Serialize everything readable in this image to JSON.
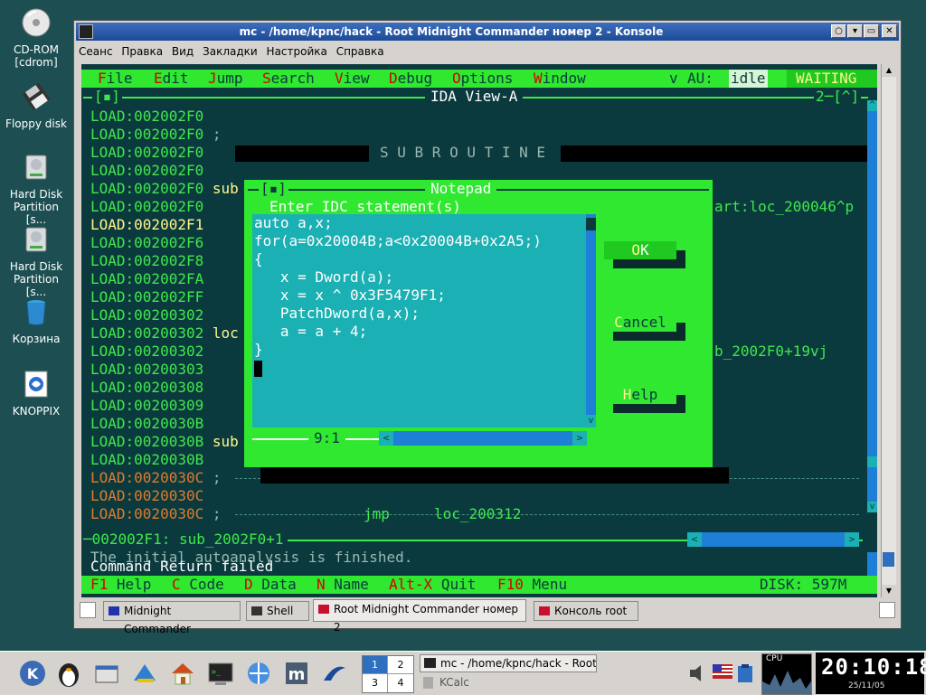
{
  "desktop": {
    "icons": [
      {
        "label": "CD-ROM\n[cdrom]",
        "icon": "cdrom-icon"
      },
      {
        "label": "Floppy disk",
        "icon": "floppy-icon"
      },
      {
        "label": "Hard Disk\nPartition [s...",
        "icon": "harddisk-icon"
      },
      {
        "label": "Hard Disk\nPartition [s...",
        "icon": "harddisk-icon"
      },
      {
        "label": "Корзина",
        "icon": "trash-icon"
      },
      {
        "label": "KNOPPIX",
        "icon": "knoppix-icon"
      }
    ]
  },
  "window": {
    "title": "mc - /home/kpnc/hack - Root Midnight Commander номер 2 - Konsole",
    "menu": [
      "Сеанс",
      "Правка",
      "Вид",
      "Закладки",
      "Настройка",
      "Справка"
    ]
  },
  "ida": {
    "menu": [
      {
        "hot": "F",
        "rest": "ile"
      },
      {
        "hot": "E",
        "rest": "dit"
      },
      {
        "hot": "J",
        "rest": "ump"
      },
      {
        "hot": "S",
        "rest": "earch"
      },
      {
        "hot": "V",
        "rest": "iew"
      },
      {
        "hot": "D",
        "rest": "ebug"
      },
      {
        "hot": "O",
        "rest": "ptions"
      },
      {
        "hot": "W",
        "rest": "indow"
      }
    ],
    "status_v": "v",
    "status_au": "AU:",
    "status_idle": "idle",
    "status_waiting": "WAITING",
    "frame_left": "[▪]",
    "frame_title": "IDA View-A",
    "frame_right": "2─[^]",
    "lines": [
      {
        "addr": "LOAD:002002F0",
        "rest": "",
        "color": "g"
      },
      {
        "addr": "LOAD:002002F0",
        "rest": " ;",
        "color": "g"
      },
      {
        "addr": "LOAD:002002F0",
        "rest": "",
        "color": "g"
      },
      {
        "addr": "LOAD:002002F0",
        "rest": "",
        "color": "g"
      },
      {
        "addr": "LOAD:002002F0",
        "rest": " sub",
        "color": "g"
      },
      {
        "addr": "LOAD:002002F0",
        "rest": "",
        "color": "g"
      },
      {
        "addr": "LOAD:002002F1",
        "rest": "",
        "color": "y"
      },
      {
        "addr": "LOAD:002002F6",
        "rest": "",
        "color": "g"
      },
      {
        "addr": "LOAD:002002F8",
        "rest": "",
        "color": "g"
      },
      {
        "addr": "LOAD:002002FA",
        "rest": "",
        "color": "g"
      },
      {
        "addr": "LOAD:002002FF",
        "rest": "",
        "color": "g"
      },
      {
        "addr": "LOAD:00200302",
        "rest": "",
        "color": "g"
      },
      {
        "addr": "LOAD:00200302",
        "rest": " loc",
        "color": "g"
      },
      {
        "addr": "LOAD:00200302",
        "rest": "",
        "color": "g"
      },
      {
        "addr": "LOAD:00200303",
        "rest": "",
        "color": "g"
      },
      {
        "addr": "LOAD:00200308",
        "rest": "",
        "color": "g"
      },
      {
        "addr": "LOAD:00200309",
        "rest": "",
        "color": "g"
      },
      {
        "addr": "LOAD:0020030B",
        "rest": "",
        "color": "g"
      },
      {
        "addr": "LOAD:0020030B",
        "rest": " sub",
        "color": "g"
      },
      {
        "addr": "LOAD:0020030B",
        "rest": "",
        "color": "g"
      },
      {
        "addr": "LOAD:0020030C",
        "rest": " ;",
        "color": "o"
      },
      {
        "addr": "LOAD:0020030C",
        "rest": "",
        "color": "o"
      },
      {
        "addr": "LOAD:0020030C",
        "rest": " ;",
        "color": "o"
      }
    ],
    "subroutine_label": "S U B R O U T I N E",
    "right_text_1": "art:loc_200046^p",
    "right_text_2": "b_2002F0+19vj",
    "jmp_op": "jmp",
    "jmp_target": "loc_200312",
    "status_line": "─002002F1: sub_2002F0+1",
    "msg1": "The initial autoanalysis is finished.",
    "msg2": "Command Return failed",
    "fkeys": [
      {
        "key": "F1",
        "label": "Help"
      },
      {
        "key": "C",
        "label": "Code"
      },
      {
        "key": "D",
        "label": "Data"
      },
      {
        "key": "N",
        "label": "Name"
      },
      {
        "key": "Alt-X",
        "label": "Quit"
      },
      {
        "key": "F10",
        "label": "Menu"
      }
    ],
    "disk": "DISK: 597M"
  },
  "notepad": {
    "frame_left": "[▪]",
    "title": "Notepad",
    "prompt": "Enter IDC statement(s)",
    "code": [
      "auto a,x;",
      "for(a=0x20004B;a<0x20004B+0x2A5;)",
      "{",
      "   x = Dword(a);",
      "   x = x ^ 0x3F5479F1;",
      "   PatchDword(a,x);",
      "   a = a + 4;",
      "}"
    ],
    "cursor_pos": "9:1",
    "ok_hot": "O",
    "ok_rest": "K",
    "cancel_hot": "C",
    "cancel_rest": "ancel",
    "help_hot": "H",
    "help_rest": "elp"
  },
  "konsole_tabs": [
    "Midnight Commander",
    "Shell",
    "Root Midnight Commander номер 2",
    "Консоль root"
  ],
  "panel": {
    "desktops": [
      "1",
      "2",
      "3",
      "4"
    ],
    "tasks": [
      "mc - /home/kpnc/hack - Root",
      "KCalc"
    ],
    "cpu_label": "CPU",
    "time": "20:10:18",
    "date": "25/11/05"
  }
}
